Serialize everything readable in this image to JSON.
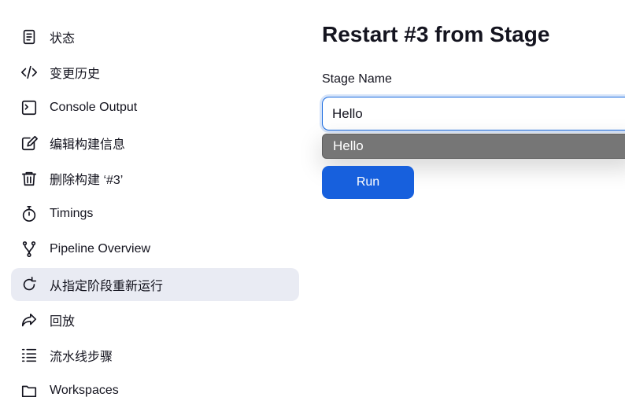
{
  "sidebar": {
    "items": [
      {
        "label": "状态",
        "icon": "document-icon"
      },
      {
        "label": "变更历史",
        "icon": "code-icon"
      },
      {
        "label": "Console Output",
        "icon": "terminal-icon"
      },
      {
        "label": "编辑构建信息",
        "icon": "edit-icon"
      },
      {
        "label": "删除构建 ‘#3’",
        "icon": "trash-icon"
      },
      {
        "label": "Timings",
        "icon": "stopwatch-icon"
      },
      {
        "label": "Pipeline Overview",
        "icon": "branch-icon"
      },
      {
        "label": "从指定阶段重新运行",
        "icon": "restart-icon",
        "active": true
      },
      {
        "label": "回放",
        "icon": "replay-arrow-icon"
      },
      {
        "label": "流水线步骤",
        "icon": "list-steps-icon"
      },
      {
        "label": "Workspaces",
        "icon": "folder-icon"
      }
    ]
  },
  "main": {
    "title": "Restart #3 from Stage",
    "stage_name_label": "Stage Name",
    "stage_name_value": "Hello",
    "suggestion": "Hello",
    "run_label": "Run"
  },
  "colors": {
    "accent": "#1760dd",
    "active_bg": "#e9ebf3",
    "suggestion_bg": "#767676"
  }
}
